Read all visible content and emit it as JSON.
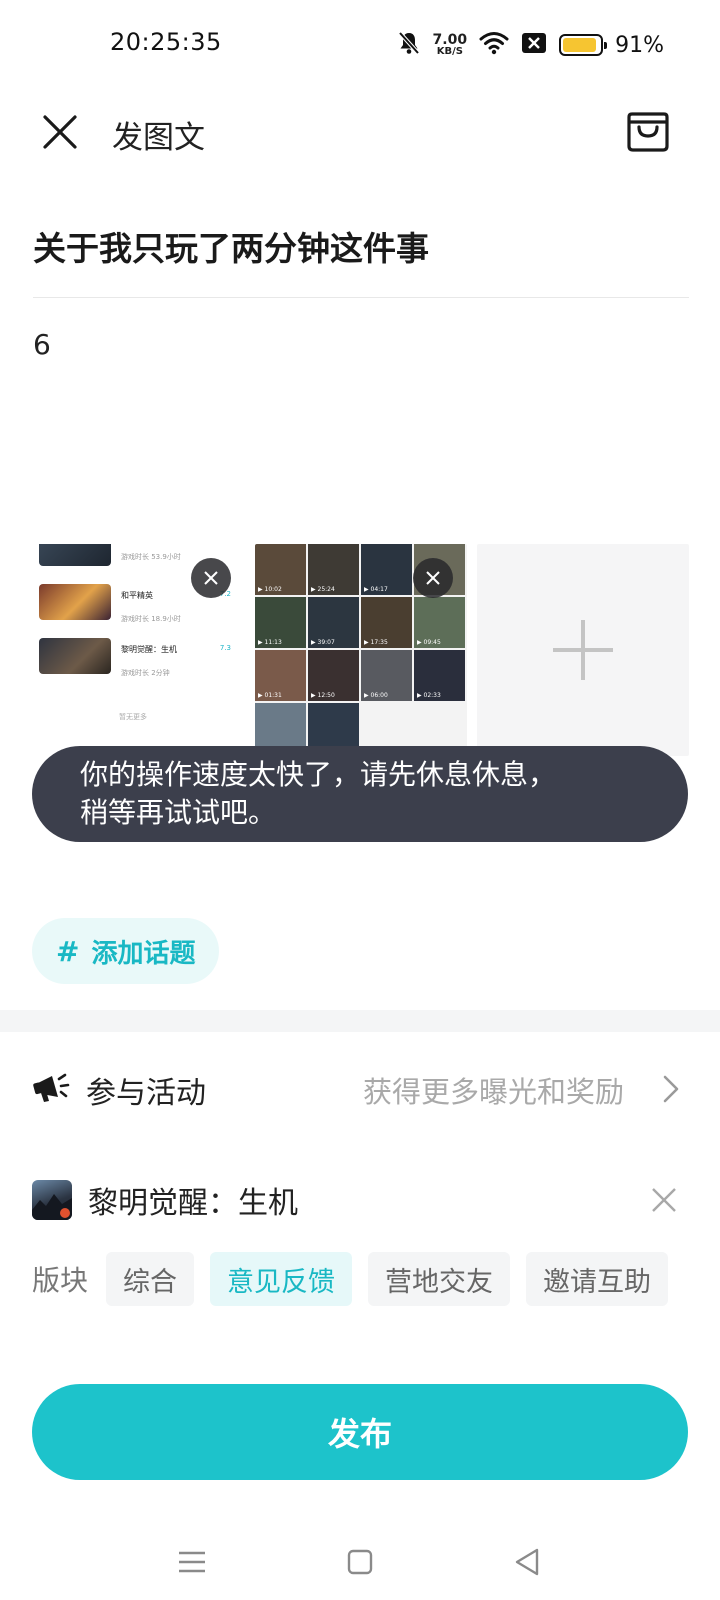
{
  "status_bar": {
    "time": "20:25:35",
    "net_speed_value": "7.00",
    "net_speed_unit": "KB/S",
    "battery_percent": "91%",
    "battery_level": 0.91,
    "battery_color": "#f6c531"
  },
  "header": {
    "title": "发图文",
    "close_icon": "close-icon",
    "drafts_icon": "drafts-box-icon"
  },
  "post": {
    "title": "关于我只玩了两分钟这件事",
    "body": "6"
  },
  "images": {
    "thumb_a": {
      "rows": [
        {
          "name": "",
          "sub": "游戏时长 53.9小时",
          "score": ""
        },
        {
          "name": "和平精英",
          "sub": "游戏时长 18.9小时",
          "score": "7.2"
        },
        {
          "name": "黎明觉醒：生机",
          "sub": "游戏时长 2分钟",
          "score": "7.3"
        }
      ],
      "more": "暂无更多"
    },
    "thumb_b": {
      "durations": [
        "10:02",
        "25:24",
        "04:17",
        "",
        "11:13",
        "39:07",
        "17:35",
        "09:45",
        "01:31",
        "12:50",
        "06:00",
        "02:33",
        "",
        "",
        "",
        ""
      ]
    }
  },
  "toast": {
    "line1": "你的操作速度太快了，请先休息休息，",
    "line2": "稍等再试试吧。"
  },
  "topic": {
    "hash": "#",
    "label": "添加话题"
  },
  "activity": {
    "label": "参与活动",
    "hint": "获得更多曝光和奖励"
  },
  "game": {
    "name": "黎明觉醒：生机"
  },
  "sections": {
    "label": "版块",
    "chips": [
      "综合",
      "意见反馈",
      "营地交友",
      "邀请互助"
    ],
    "selected": "意见反馈"
  },
  "publish": {
    "label": "发布"
  },
  "colors": {
    "accent": "#1dc3cb",
    "toast_bg": "#3c3f4c",
    "chip_active_bg": "#e6f8f9"
  }
}
